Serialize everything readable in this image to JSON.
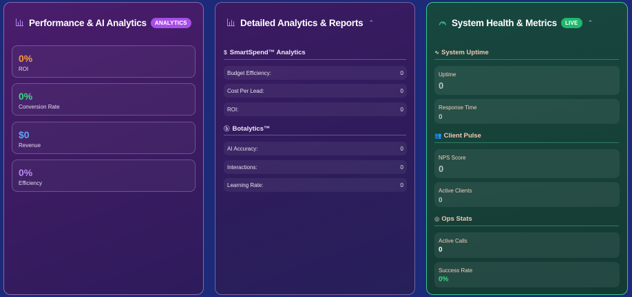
{
  "panels": {
    "performance": {
      "title": "Performance & AI Analytics",
      "badge": "ANALYTICS",
      "icon": "bar-chart-icon",
      "metrics": [
        {
          "value": "0%",
          "label": "ROI",
          "color": "#f59a3c"
        },
        {
          "value": "0%",
          "label": "Conversion Rate",
          "color": "#3fd684"
        },
        {
          "value": "$0",
          "label": "Revenue",
          "color": "#5ba7f5"
        },
        {
          "value": "0%",
          "label": "Efficiency",
          "color": "#b98af0"
        }
      ]
    },
    "detailed": {
      "title": "Detailed Analytics & Reports",
      "icon": "bar-chart-icon",
      "chevron": "chevron-up-icon",
      "sections": [
        {
          "icon": "$",
          "title": "SmartSpend™ Analytics",
          "rows": [
            {
              "label": "Budget Efficiency:",
              "value": "0"
            },
            {
              "label": "Cost Per Lead:",
              "value": "0"
            },
            {
              "label": "ROI:",
              "value": "0"
            }
          ]
        },
        {
          "icon": "ⓑ",
          "title": "Botalytics™",
          "rows": [
            {
              "label": "AI Accuracy:",
              "value": "0"
            },
            {
              "label": "Interactions:",
              "value": "0"
            },
            {
              "label": "Learning Rate:",
              "value": "0"
            }
          ]
        }
      ]
    },
    "health": {
      "title": "System Health & Metrics",
      "badge": "LIVE",
      "icon": "gauge-icon",
      "chevron": "chevron-up-icon",
      "sections": [
        {
          "icon": "∿",
          "title": "System Uptime",
          "metrics": [
            {
              "label": "Uptime",
              "value": "0",
              "color": "#b8c4c0"
            },
            {
              "label": "Response Time",
              "value": "0",
              "color": "#b8c4c0"
            }
          ]
        },
        {
          "icon": "👥",
          "title": "Client Pulse",
          "metrics": [
            {
              "label": "NPS Score",
              "value": "0",
              "color": "#b8c4c0"
            },
            {
              "label": "Active Clients",
              "value": "0",
              "color": "#b8c4c0"
            }
          ]
        },
        {
          "icon": "◎",
          "title": "Ops Stats",
          "metrics": [
            {
              "label": "Active Calls",
              "value": "0",
              "color": "#ffffff"
            },
            {
              "label": "Success Rate",
              "value": "0%",
              "color": "#3fd684"
            }
          ]
        }
      ]
    }
  },
  "colors": {
    "analytics_badge": "#a74ee8",
    "live_badge": "#1fb86e",
    "health_border": "#37c88f"
  }
}
